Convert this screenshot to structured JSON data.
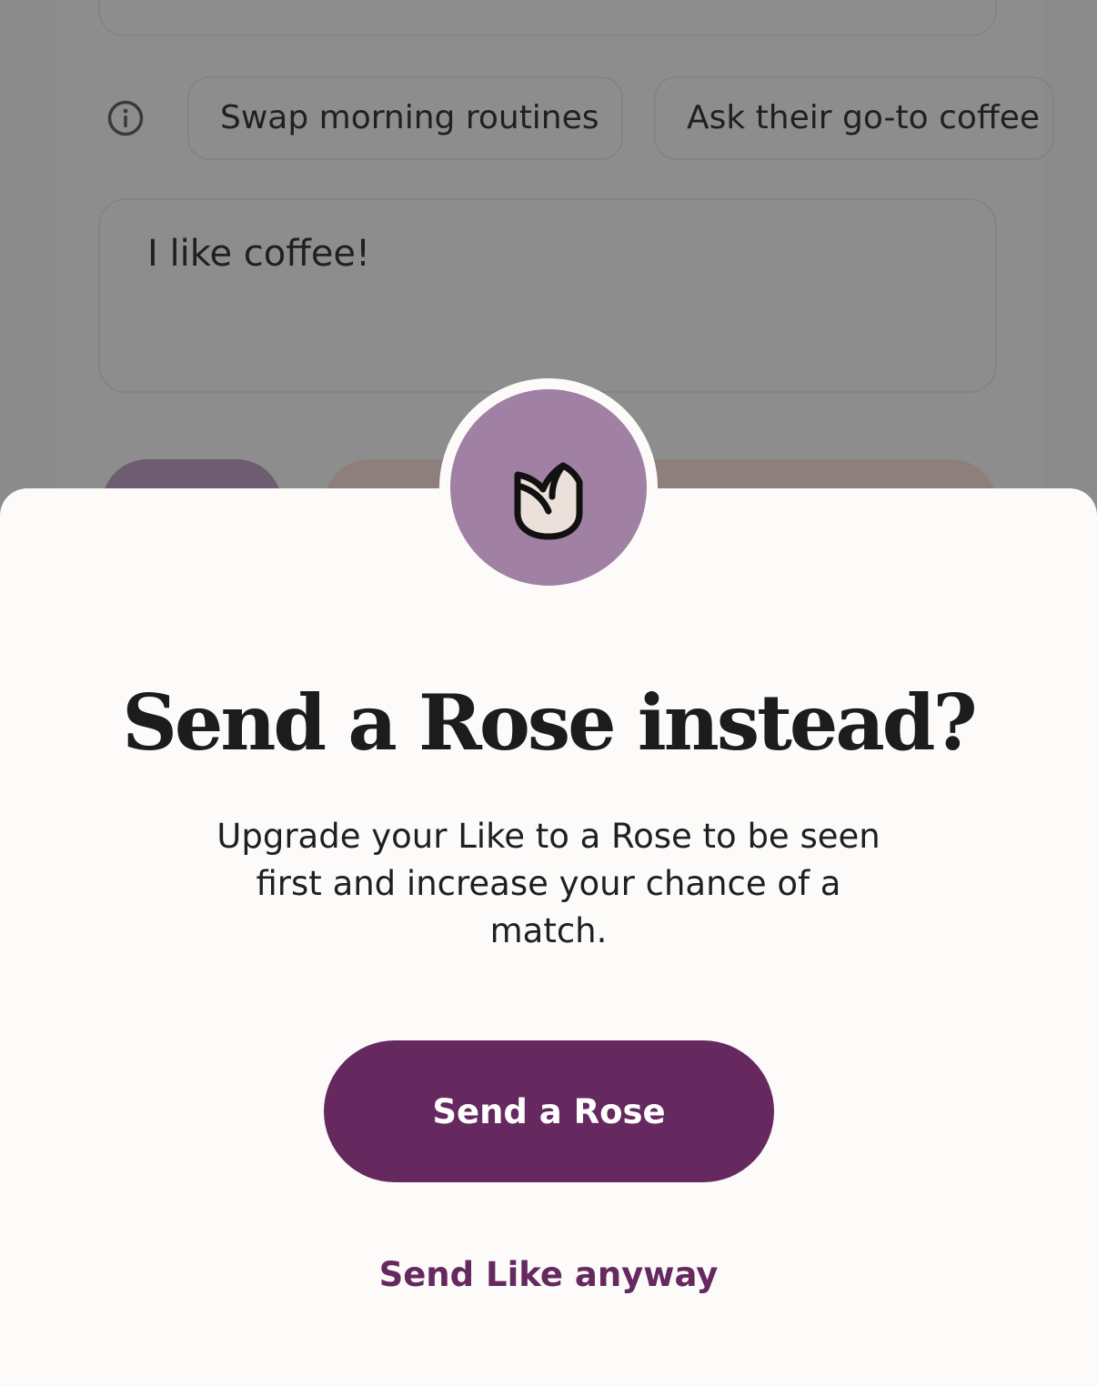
{
  "background": {
    "prompt_chips": [
      {
        "label": "Swap morning routines"
      },
      {
        "label": "Ask their go-to coffee"
      }
    ],
    "message_text": "I like coffee!"
  },
  "sheet": {
    "icon": "rose-icon",
    "title": "Send a Rose instead?",
    "body": "Upgrade your Like to a Rose to be seen first and increase your chance of a match.",
    "primary_button": "Send a Rose",
    "secondary_link": "Send Like anyway"
  },
  "colors": {
    "brand_purple": "#65285f",
    "rose_circle": "#a080a3",
    "sheet_background": "#fcfbfa",
    "overlay": "#8b8b8b"
  }
}
